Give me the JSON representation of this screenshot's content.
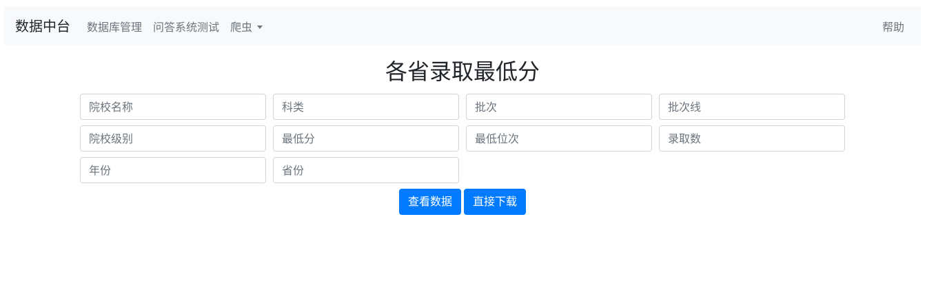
{
  "navbar": {
    "brand": "数据中台",
    "links": [
      {
        "label": "数据库管理"
      },
      {
        "label": "问答系统测试"
      },
      {
        "label": "爬虫"
      }
    ],
    "help": "帮助"
  },
  "page": {
    "title": "各省录取最低分"
  },
  "form": {
    "fields": [
      {
        "placeholder": "院校名称",
        "value": ""
      },
      {
        "placeholder": "科类",
        "value": ""
      },
      {
        "placeholder": "批次",
        "value": ""
      },
      {
        "placeholder": "批次线",
        "value": ""
      },
      {
        "placeholder": "院校级别",
        "value": ""
      },
      {
        "placeholder": "最低分",
        "value": ""
      },
      {
        "placeholder": "最低位次",
        "value": ""
      },
      {
        "placeholder": "录取数",
        "value": ""
      },
      {
        "placeholder": "年份",
        "value": ""
      },
      {
        "placeholder": "省份",
        "value": ""
      }
    ],
    "view_button": "查看数据",
    "download_button": "直接下载"
  },
  "colors": {
    "primary": "#007bff",
    "navbar_bg": "#f8f9fa",
    "nav_text": "#6c757d",
    "title_text": "#212529",
    "input_border": "#ced4da"
  }
}
